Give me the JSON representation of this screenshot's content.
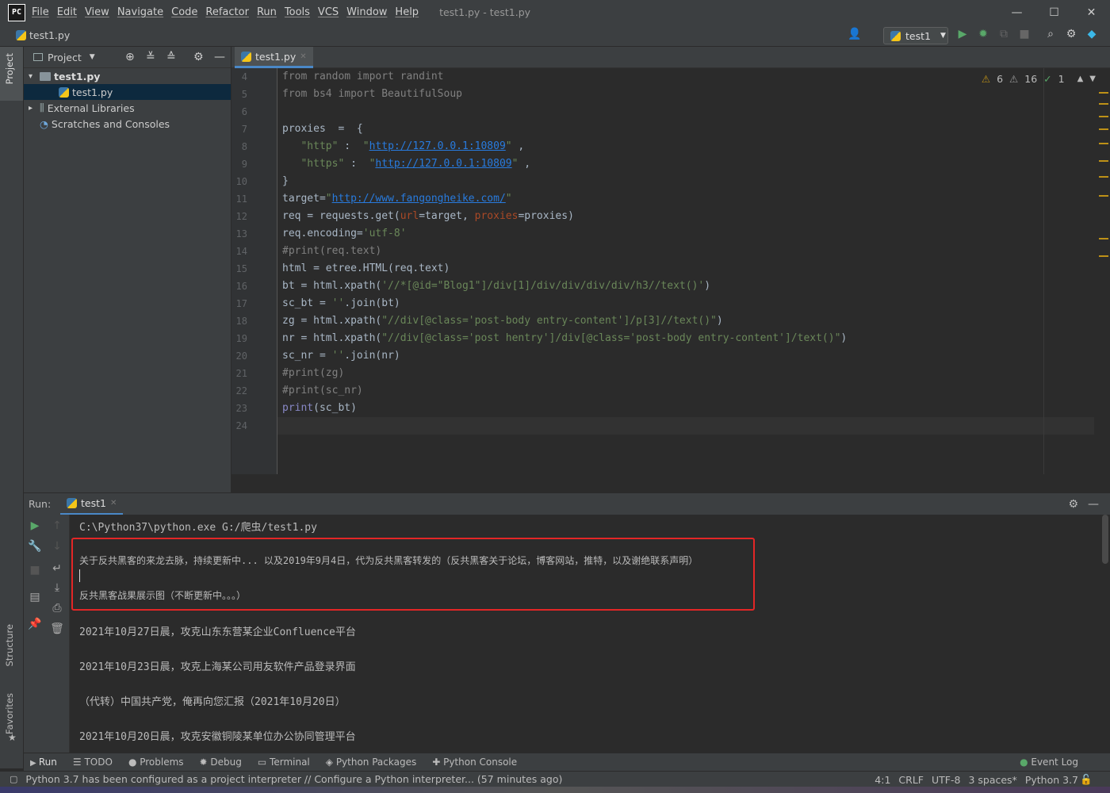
{
  "app": {
    "logo": "PC",
    "window_title": "test1.py - test1.py"
  },
  "menu": [
    "File",
    "Edit",
    "View",
    "Navigate",
    "Code",
    "Refactor",
    "Run",
    "Tools",
    "VCS",
    "Window",
    "Help"
  ],
  "window_controls": {
    "minimize": "—",
    "maximize": "☐",
    "close": "✕"
  },
  "navbar": {
    "breadcrumb": "test1.py",
    "run_config": "test1"
  },
  "left_strip": {
    "project": "Project",
    "structure": "Structure",
    "favorites": "Favorites"
  },
  "project_panel": {
    "header": "Project",
    "tree": [
      {
        "label": "test1.py",
        "bold": true
      },
      {
        "label": "test1.py",
        "selected": true
      },
      {
        "label": "External Libraries"
      },
      {
        "label": "Scratches and Consoles"
      }
    ]
  },
  "editor": {
    "tab": "test1.py",
    "inspections": {
      "warn1": "6",
      "warn2": "16",
      "ok": "1"
    },
    "line_numbers": [
      "4",
      "5",
      "6",
      "7",
      "8",
      "9",
      "10",
      "11",
      "12",
      "13",
      "14",
      "15",
      "16",
      "17",
      "18",
      "19",
      "20",
      "21",
      "22",
      "23",
      "24"
    ]
  },
  "run_panel": {
    "label": "Run:",
    "tab": "test1",
    "lines": [
      "C:\\Python37\\python.exe G:/爬虫/test1.py",
      "关于反共黑客的来龙去脉，持续更新中... 以及2019年9月4日，代为反共黑客转发的（反共黑客关于论坛，博客网站，推特，以及谢绝联系声明）",
      "反共黑客战果展示图（不断更新中。。。）",
      "2021年10月27日晨，攻克山东东营某企业Confluence平台",
      "2021年10月23日晨，攻克上海某公司用友软件产品登录界面",
      "（代转）中国共产党，俺再向您汇报（2021年10月20日）",
      "2021年10月20日晨，攻克安徽铜陵某单位办公协同管理平台"
    ]
  },
  "bottom_tabs": [
    "Run",
    "TODO",
    "Problems",
    "Debug",
    "Terminal",
    "Python Packages",
    "Python Console"
  ],
  "event_log": "Event Log",
  "status": {
    "message": "Python 3.7 has been configured as a project interpreter // Configure a Python interpreter... (57 minutes ago)",
    "position": "4:1",
    "line_sep": "CRLF",
    "encoding": "UTF-8",
    "indent": "3 spaces*",
    "interpreter": "Python 3.7"
  },
  "colors": {
    "accent": "#4a88c7",
    "highlight_box": "#e32626",
    "warning": "#be9117"
  }
}
